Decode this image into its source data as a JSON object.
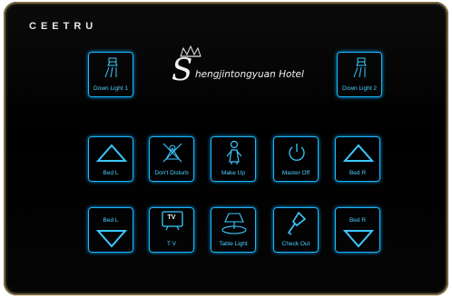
{
  "brand": "CEETRU",
  "hotel_name": "hengjintongyuan Hotel",
  "hotel_initial": "S",
  "accent_color": "#1ab8ff",
  "buttons": {
    "down_light_1": {
      "label": "Down Light 1",
      "icon": "downlight-icon"
    },
    "down_light_2": {
      "label": "Down Light 2",
      "icon": "downlight-icon"
    },
    "bed_l_up": {
      "label": "Bed L",
      "icon": "triangle-up-icon"
    },
    "dont_disturb": {
      "label": "Don't Disturb",
      "icon": "do-not-disturb-icon"
    },
    "make_up": {
      "label": "Make Up",
      "icon": "maid-icon"
    },
    "master_off": {
      "label": "Master Off",
      "icon": "power-icon"
    },
    "bed_r_up": {
      "label": "Bed R",
      "icon": "triangle-up-icon"
    },
    "bed_l_down": {
      "label": "Bed L",
      "icon": "triangle-down-icon"
    },
    "tv": {
      "label": "T V",
      "icon_text": "TV",
      "icon": "tv-icon"
    },
    "table_light": {
      "label": "Table Light",
      "icon": "table-lamp-icon"
    },
    "check_out": {
      "label": "Check Out",
      "icon": "key-icon"
    },
    "bed_r_down": {
      "label": "Bed R",
      "icon": "triangle-down-icon"
    }
  }
}
